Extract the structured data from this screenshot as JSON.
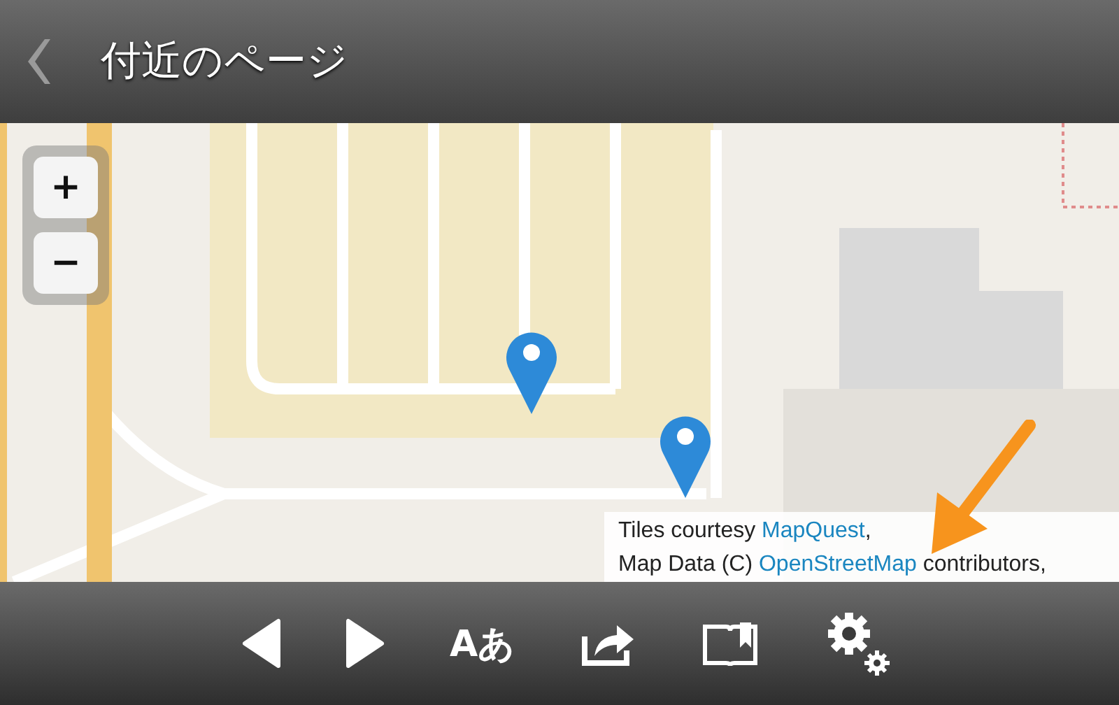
{
  "header": {
    "title": "付近のページ"
  },
  "map": {
    "zoom_buttons": [
      "+",
      "−"
    ],
    "attribution": [
      {
        "before": "Tiles courtesy ",
        "link": "MapQuest",
        "after": ","
      },
      {
        "before": "Map Data (C) ",
        "link": "OpenStreetMap",
        "after": " contributors,"
      }
    ]
  },
  "toolbar": {
    "text_size_label": "Aあ"
  }
}
